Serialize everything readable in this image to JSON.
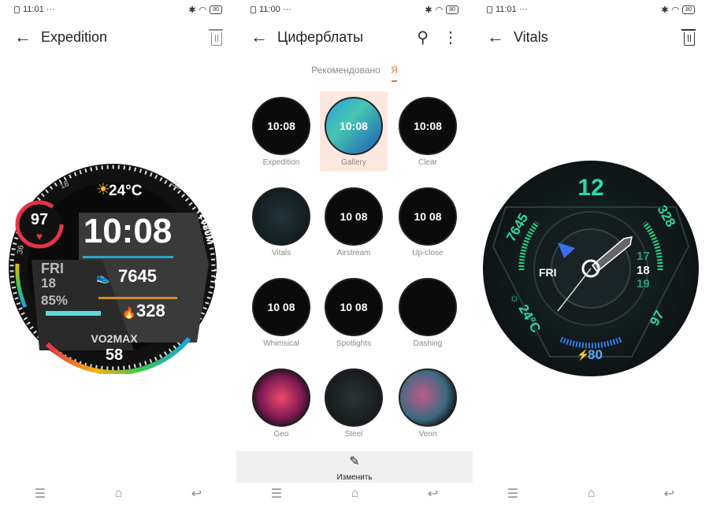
{
  "panels": [
    {
      "status": {
        "time": "11:01 ···",
        "battery": "80"
      },
      "title": "Expedition",
      "action": "trash-icon"
    },
    {
      "status": {
        "time": "11:00 ···",
        "battery": "80"
      },
      "title": "Циферблаты",
      "actions": [
        "search-icon",
        "more-vert-icon"
      ]
    },
    {
      "status": {
        "time": "11:01 ···",
        "battery": "80"
      },
      "title": "Vitals",
      "action": "trash-icon"
    }
  ],
  "expedition": {
    "temp": "24°C",
    "heart_rate": "97",
    "time": "10:08",
    "day": "FRI",
    "date": "18",
    "battery": "85%",
    "steps": "7645",
    "calories": "328",
    "vo2_label": "VO2MAX",
    "vo2_value": "58",
    "scale_left": "18",
    "scale_right": "32",
    "scale_side": "36",
    "altitude": "▲2680M",
    "pressure": "742 HPA"
  },
  "gallery": {
    "tabs": {
      "recommended": "Рекомендовано",
      "mine": "Я"
    },
    "selected": "Gallery",
    "items": [
      {
        "name": "Expedition",
        "preview": "10:08"
      },
      {
        "name": "Gallery",
        "preview": "10:08"
      },
      {
        "name": "Clear",
        "preview": "10:08"
      },
      {
        "name": "Vitals",
        "preview": ""
      },
      {
        "name": "Airstream",
        "preview": "10 08"
      },
      {
        "name": "Up-close",
        "preview": "10 08"
      },
      {
        "name": "Whimsical",
        "preview": "10 08"
      },
      {
        "name": "Spotlights",
        "preview": "10 08"
      },
      {
        "name": "Dashing",
        "preview": ""
      },
      {
        "name": "Geo",
        "preview": ""
      },
      {
        "name": "Steel",
        "preview": ""
      },
      {
        "name": "Venn",
        "preview": ""
      }
    ],
    "edit_label": "Изменить"
  },
  "vitals": {
    "hour_mark": "12",
    "steps": "7645",
    "calories": "328",
    "day": "FRI",
    "date_prev": "17",
    "date": "18",
    "date_next": "19",
    "temp": "24°C",
    "heart_rate": "97",
    "battery": "80"
  },
  "colors": {
    "accent": "#e8772e",
    "vitals_green": "#2fd9a0",
    "selected_bg": "#fde8df"
  }
}
